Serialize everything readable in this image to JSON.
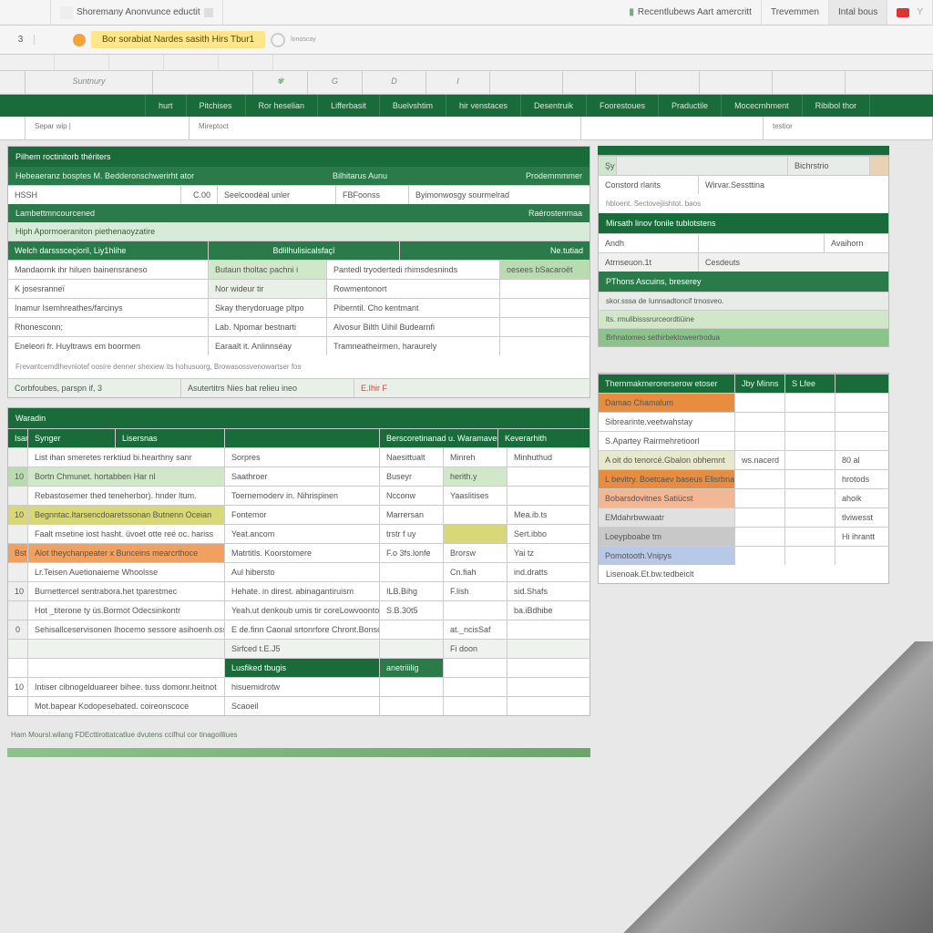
{
  "topbar": {
    "left_tab": "Shoremany Anonvunce eductit",
    "right_tab1": "Recentlubews Aart amercritt",
    "right_tab2": "Trevemmen",
    "right_tab3": "Intal bous"
  },
  "banner": {
    "num": "3",
    "highlight": "Bor sorabiat Nardes sasith Hirs Tbur1",
    "small": "lonoscay"
  },
  "thinbar": [
    "",
    "",
    "",
    "",
    ""
  ],
  "columns": [
    "Suntnury",
    "",
    "",
    "G",
    "D",
    "I",
    "",
    "",
    "",
    ""
  ],
  "ribbon": [
    "hurt",
    "Pitchises",
    "Ror heselian",
    "Lifferbasit",
    "Buelvshtim",
    "hir venstaces",
    "Desentruik",
    "Foorestoues",
    "Praductile",
    "Mocecrnhment",
    "Ribibol thor"
  ],
  "ctx": {
    "a": "Separ wip |",
    "b": "Mireptoct",
    "c": "testior"
  },
  "left": {
    "block1": {
      "title1": "Pilhem roctinitorb thériters",
      "title2": "Hebeaeranz bosptes M. Bedderonschwerirht ator",
      "header_row": [
        "Bilhitarus Aunu",
        "",
        "Prodemmmmer"
      ],
      "row1": [
        "HSSH",
        "C.00",
        "Seelcoodéal unler",
        "FBFoonss",
        "Byimonwosgy sourmelrad"
      ],
      "bar_dark": "Lambettmncourcened",
      "bar_dark_r": "Raérostenmaa",
      "sub_lt": "Hiph Apormoeraniton piethenaoyzatire",
      "sub_hdr": [
        "Welch darsssceçioril, Liy1hlihe",
        "Bdlilhulisicalsfaçï",
        "Ne.tutiad"
      ],
      "rows": [
        [
          "Mandaornk ihr hiluen bainensraneso",
          "Butaun tholtac pachni i",
          "Pantedl tryodertedi rhimsdesninds",
          "oesees bSacaroët"
        ],
        [
          "K josesranneï",
          "Nor wideur tir",
          "Rowmentonort",
          ""
        ],
        [
          "Inamur Isemhreathes/farcinys",
          "Skay therydoruage pltpo",
          "Piberntil. Cho kentmant",
          ""
        ],
        [
          "Rhonesconn;",
          "Lab. Npomar bestnarti",
          "Alvosur Bilth Uihil Budearnfi",
          ""
        ],
        [
          "Eneleori fr. Huyltraws em boormen",
          "Earaalt it. Anlinnséay",
          "Tramneatheirmen, haraurely",
          ""
        ]
      ],
      "foot1": "Frevantcemdlhevniotef oosire denner shexiew its hohusuorg, Browasossvenowartser fos",
      "foot2_a": "Corbfoubes, parspn if, 3",
      "foot2_b": "Asutertitrs Nies bat relieu ineo",
      "foot2_c": "E.Ihir F"
    },
    "block2": {
      "title": "Waradin",
      "headers": [
        "Isant",
        "Synger",
        "Lisersnas",
        "Berscoretinanad u. Waramaverannt",
        "Keverarhith"
      ],
      "rows": [
        [
          "",
          "List ihan smeretes rerktiud bi.hearthny sanr",
          "Sorpres",
          "Naesittualt",
          "Minreh",
          "Minhuthud"
        ],
        [
          "10",
          "Bortn Chmunet. hortabben Har nl",
          "Saathroer",
          "Buseyr",
          "herith.y",
          ""
        ],
        [
          "",
          "Rebastosemer thed teneherbor). hnder ltum.",
          "Toernemoderv in. Nihrispinen",
          "Ncconw",
          "Yaaslitises",
          ""
        ],
        [
          "10",
          "Begnntac.Itarsencdoaretssonan Butnenn Oceian",
          "Fontemor",
          "Marrersan",
          "",
          "Mea.ib.ts"
        ],
        [
          "",
          "Faalt msetine iost hasht. üvoet otte reé oc. hariss",
          "Yeat.ancom",
          "trstr f uy",
          "",
          "Sert.ibbo"
        ],
        [
          "Bst",
          "Alot theychanpeater x Bunceins mearcrthoce",
          "Matrtitls. Koorstomere",
          "F.o 3fs.lonfe",
          "Brorsw",
          "Yai tz"
        ],
        [
          "",
          "Lr.Teisen Auetionaieme Whoolsse",
          "Aul hibersto",
          "",
          "Cn.fiah",
          "ind.dratts"
        ],
        [
          "10",
          "Burnettercel sentrabora.het tparestmec",
          "Hehate. in direst. abinagantiruism",
          "ILB.Bihg",
          "F.lish",
          "sid.Shafs"
        ],
        [
          "",
          "Hot _titerone ty üs.Bormot Odecsinkontr",
          "Yeah.ut denkoub umis tir coreLowvoontoco.",
          "S.B.30t5",
          "",
          "ba.iBdhibe"
        ],
        [
          "0",
          "Sehisallceservisonen Ihocemo sessore asihoenh.oss",
          "E de.finn Caonal srtonrfore Chront.Bonsors",
          "",
          "at._ncisSaf",
          ""
        ]
      ],
      "under": [
        "Sirfced t.E.J5",
        "Fi doon"
      ],
      "under2": "Lusfiked tbugis",
      "under3": "anetriiilig",
      "tail": [
        [
          "10",
          "Intiser cibnogelduareer bihee. tuss domonr.heitnot",
          "hisuemidrotw",
          "",
          "",
          ""
        ],
        [
          "",
          "Mot.bapear Kodopesebated. coireonscoce",
          "Scaoeil",
          "",
          "",
          ""
        ]
      ],
      "final": "Ham Moursl.wilang  FDEcttirottatcatlue dvutens ccifhul cor tinagoilliues"
    }
  },
  "right": {
    "top": {
      "bar_lbl": "Şy",
      "hdr_r": "Bichrstrio",
      "rowA": [
        "Constord rlarits",
        "Wirvar.Sessttina"
      ],
      "sub": "hbloent. Sectovejiishtot. baos",
      "hdr2": "Mirsath linov fonile tublotstens",
      "rowB": [
        "Andh",
        "",
        "Avaihorn"
      ],
      "rowC": [
        "Atrnseuon.1t",
        "Cesdeuts",
        ""
      ],
      "hdr3": "PThons Ascuins, breserey",
      "list": [
        "skor.sssa de Iunnsadtoncif trnosveo.",
        "lts. rmulibisssrurceordtiüine",
        "Brhnatomeo sethirbektoweertrodua"
      ]
    },
    "table": {
      "headers": [
        "Thernmakmerorerserow etoser",
        "Jby Minns",
        "S Lfee"
      ],
      "rows": [
        {
          "c": "#e88c3f",
          "a": "Damao Chamalum",
          "b": "",
          "d": ""
        },
        {
          "c": "#fff",
          "a": "Sibrearinte.veetwahstay",
          "b": "",
          "d": ""
        },
        {
          "c": "#fff",
          "a": "S.Apartey Rairmehretioorl",
          "b": "",
          "d": ""
        },
        {
          "c": "#e8e8cc",
          "a": "A oit do tenorcé.Gbalon obhemnt",
          "b": "ws.nacerd",
          "d": "80 al"
        },
        {
          "c": "#e88c3f",
          "a": "L bevitry. Boetcaev baseus Elisrbnard A hequal hi ont expresor dispor",
          "b": "",
          "d": "hrotods"
        },
        {
          "c": "#f2b896",
          "a": "Bobarsdovitnes Satiücst",
          "b": "",
          "d": "ahoik"
        },
        {
          "c": "#e0e0e0",
          "a": "EMdahrbwwaatr",
          "b": "",
          "d": "tlviwesst"
        },
        {
          "c": "#c8c8c8",
          "a": "Loeypboabe tm",
          "b": "",
          "d": "Hi ihrantt"
        },
        {
          "c": "#b8c8e8",
          "a": "Pomotooth.Vnipys",
          "b": "",
          "d": ""
        }
      ],
      "foot": "Lisenoak.Et.bw.tedbeiclt"
    }
  }
}
